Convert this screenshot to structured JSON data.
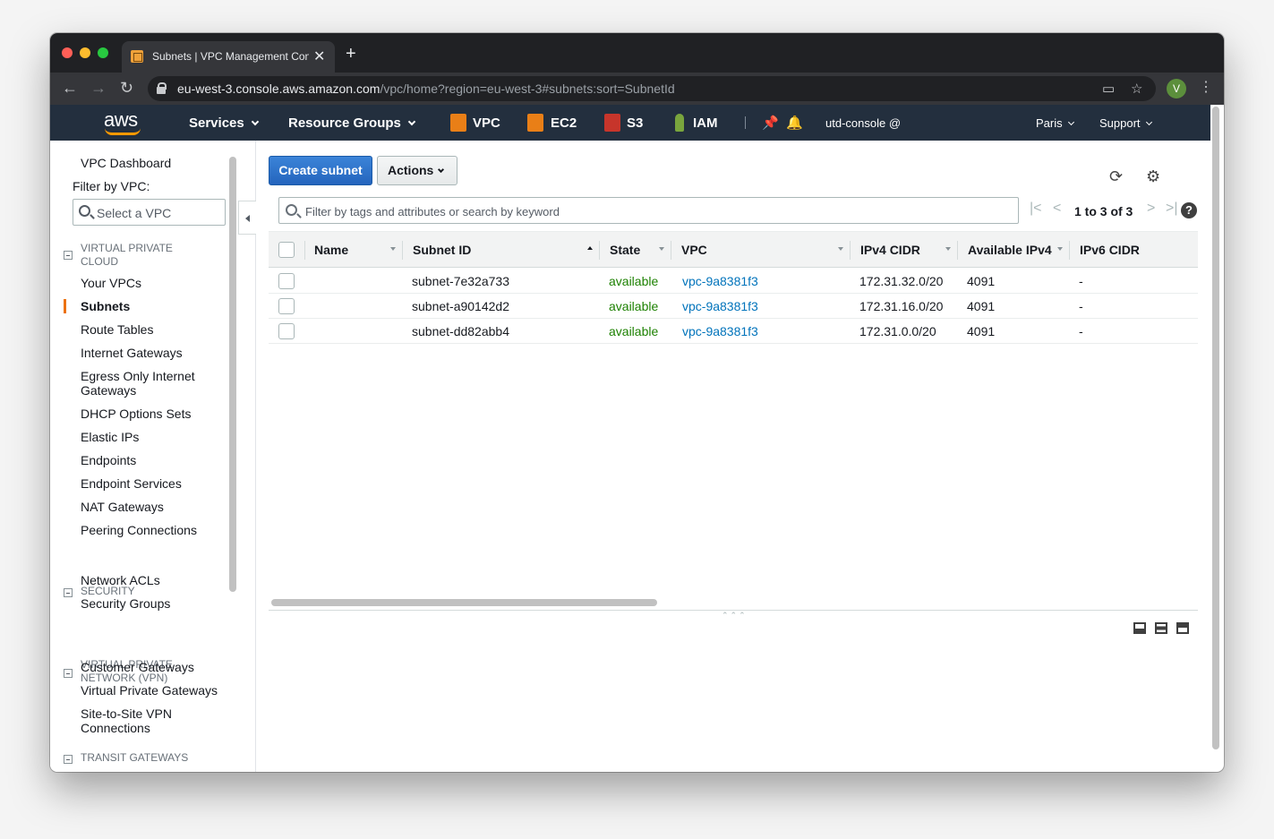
{
  "browser": {
    "tab_title": "Subnets | VPC Management Console",
    "url_host": "eu-west-3.console.aws.amazon.com",
    "url_path": "/vpc/home?region=eu-west-3#subnets:sort=SubnetId",
    "avatar_letter": "V"
  },
  "aws_nav": {
    "logo": "aws",
    "services": "Services",
    "resource_groups": "Resource Groups",
    "vpc": "VPC",
    "ec2": "EC2",
    "s3": "S3",
    "iam": "IAM",
    "account": "utd-console @",
    "region": "Paris",
    "support": "Support"
  },
  "sidebar": {
    "dashboard": "VPC Dashboard",
    "filter_label": "Filter by VPC:",
    "vpc_select_placeholder": "Select a VPC",
    "groups": [
      {
        "label": "VIRTUAL PRIVATE CLOUD"
      },
      {
        "label": "SECURITY"
      },
      {
        "label": "VIRTUAL PRIVATE NETWORK (VPN)"
      },
      {
        "label": "TRANSIT GATEWAYS"
      }
    ],
    "items": [
      "Your VPCs",
      "Subnets",
      "Route Tables",
      "Internet Gateways",
      "Egress Only Internet Gateways",
      "DHCP Options Sets",
      "Elastic IPs",
      "Endpoints",
      "Endpoint Services",
      "NAT Gateways",
      "Peering Connections",
      "Network ACLs",
      "Security Groups",
      "Customer Gateways",
      "Virtual Private Gateways",
      "Site-to-Site VPN Connections"
    ],
    "active_item": "Subnets"
  },
  "toolbar": {
    "create_label": "Create subnet",
    "actions_label": "Actions"
  },
  "search": {
    "placeholder": "Filter by tags and attributes or search by keyword"
  },
  "pager": {
    "text": "1 to 3 of 3"
  },
  "table": {
    "columns": [
      "Name",
      "Subnet ID",
      "State",
      "VPC",
      "IPv4 CIDR",
      "Available IPv4",
      "IPv6 CIDR"
    ],
    "sorted_column": "Subnet ID",
    "rows": [
      {
        "name": "",
        "subnet_id": "subnet-7e32a733",
        "state": "available",
        "vpc": "vpc-9a8381f3",
        "ipv4_cidr": "172.31.32.0/20",
        "available_ipv4": "4091",
        "ipv6_cidr": "-"
      },
      {
        "name": "",
        "subnet_id": "subnet-a90142d2",
        "state": "available",
        "vpc": "vpc-9a8381f3",
        "ipv4_cidr": "172.31.16.0/20",
        "available_ipv4": "4091",
        "ipv6_cidr": "-"
      },
      {
        "name": "",
        "subnet_id": "subnet-dd82abb4",
        "state": "available",
        "vpc": "vpc-9a8381f3",
        "ipv4_cidr": "172.31.0.0/20",
        "available_ipv4": "4091",
        "ipv6_cidr": "-"
      }
    ]
  },
  "colors": {
    "aws_header": "#232f3e",
    "aws_orange": "#ff9900",
    "primary_button": "#2464bd",
    "state_available": "#1d8102",
    "link": "#0073bb"
  }
}
